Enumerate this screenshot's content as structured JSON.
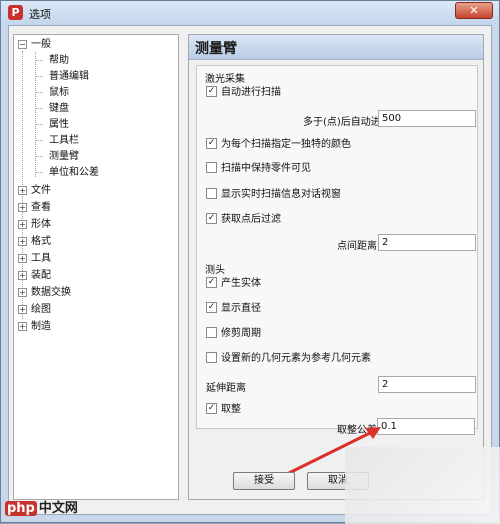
{
  "window": {
    "title": "选项",
    "app_icon_letter": "P",
    "close_glyph": "✕"
  },
  "tree": {
    "root": {
      "label": "一般",
      "expanded": true
    },
    "children": [
      "帮助",
      "普通编辑",
      "鼠标",
      "键盘",
      "属性",
      "工具栏",
      "测量臂",
      "单位和公差"
    ],
    "siblings": [
      "文件",
      "查看",
      "形体",
      "格式",
      "工具",
      "装配",
      "数据交换",
      "绘图",
      "制造"
    ]
  },
  "panel": {
    "title": "测量臂",
    "laser_group": {
      "title": "激光采集",
      "auto_scan": {
        "label": "自动进行扫描",
        "checked": true
      },
      "auto_after_points": {
        "label": "多于(点)后自动进行",
        "value": "500"
      },
      "unique_color": {
        "label": "为每个扫描指定一独特的颜色",
        "checked": true
      },
      "keep_visible": {
        "label": "扫描中保持零件可见",
        "checked": false
      },
      "show_realtime": {
        "label": "显示实时扫描信息对话视窗",
        "checked": false
      },
      "filter_points": {
        "label": "获取点后过滤",
        "checked": true
      },
      "point_distance": {
        "label": "点间距离",
        "value": "2"
      }
    },
    "probe_group": {
      "title": "测头",
      "create_solid": {
        "label": "产生实体",
        "checked": true
      },
      "show_diameter": {
        "label": "显示直径",
        "checked": true
      },
      "trim_cycle": {
        "label": "修剪周期",
        "checked": false
      },
      "new_geom_ref": {
        "label": "设置新的几何元素为参考几何元素",
        "checked": false
      },
      "extend_distance": {
        "label": "延伸距离",
        "value": "2"
      },
      "round": {
        "label": "取整",
        "checked": true
      },
      "round_tolerance": {
        "label": "取整公差",
        "value": "0.1"
      }
    }
  },
  "buttons": {
    "accept": "接受",
    "cancel": "取消"
  },
  "watermark": {
    "badge": "php",
    "text": "中文网"
  },
  "colors": {
    "arrow": "#d9302a"
  }
}
